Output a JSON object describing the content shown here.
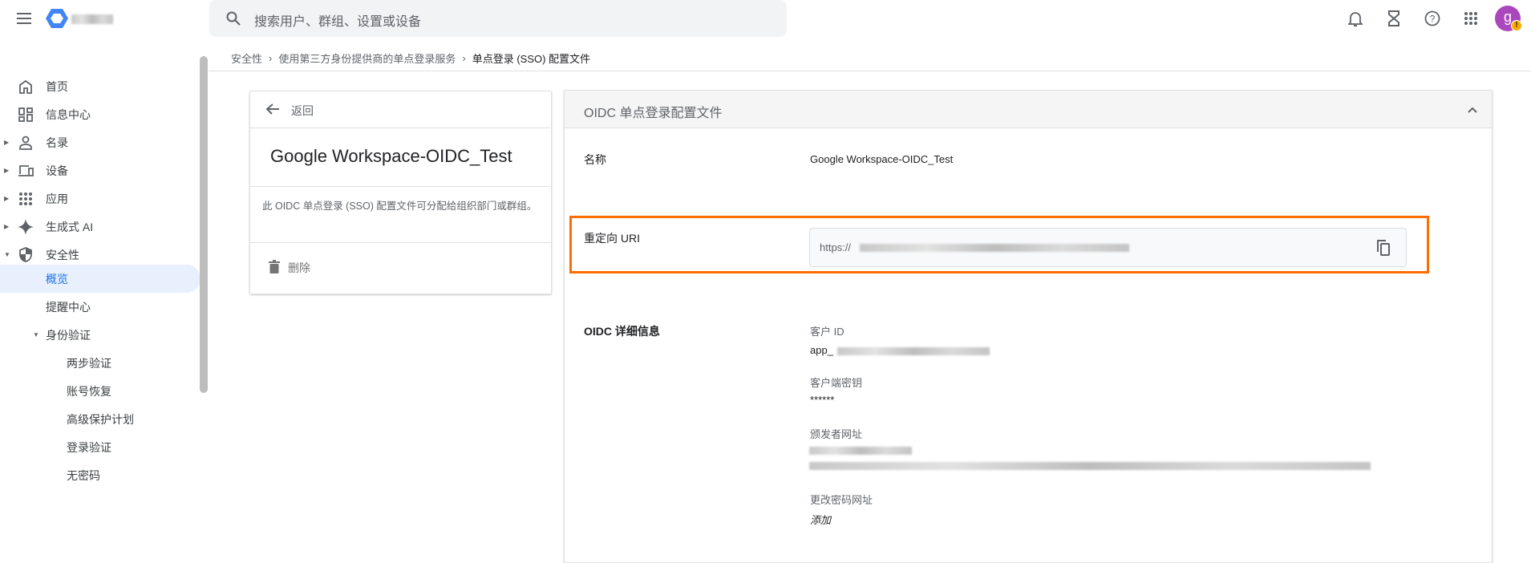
{
  "topbar": {
    "search_placeholder": "搜索用户、群组、设置或设备",
    "avatar_letter": "g"
  },
  "breadcrumb": [
    "安全性",
    "使用第三方身份提供商的单点登录服务",
    "单点登录 (SSO) 配置文件"
  ],
  "sidebar": {
    "items": [
      {
        "label": "首页",
        "icon": "home-icon"
      },
      {
        "label": "信息中心",
        "icon": "dashboard-icon"
      },
      {
        "label": "名录",
        "icon": "person-icon"
      },
      {
        "label": "设备",
        "icon": "devices-icon"
      },
      {
        "label": "应用",
        "icon": "apps-icon"
      },
      {
        "label": "生成式 AI",
        "icon": "sparkle-icon"
      },
      {
        "label": "安全性",
        "icon": "shield-icon"
      },
      {
        "label": "概览"
      },
      {
        "label": "提醒中心"
      },
      {
        "label": "身份验证"
      },
      {
        "label": "两步验证"
      },
      {
        "label": "账号恢复"
      },
      {
        "label": "高级保护计划"
      },
      {
        "label": "登录验证"
      },
      {
        "label": "无密码"
      }
    ]
  },
  "left_card": {
    "back": "返回",
    "title": "Google Workspace-OIDC_Test",
    "description": "此 OIDC 单点登录 (SSO) 配置文件可分配给组织部门或群组。",
    "delete": "删除"
  },
  "right_card": {
    "header": "OIDC 单点登录配置文件",
    "name_label": "名称",
    "name_value": "Google Workspace-OIDC_Test",
    "redirect_label": "重定向 URI",
    "redirect_prefix": "https://",
    "details_label": "OIDC 详细信息",
    "client_id_label": "客户 ID",
    "client_id_prefix": "app_",
    "secret_label": "客户端密钥",
    "secret_value": "******",
    "issuer_label": "颁发者网址",
    "change_pwd_label": "更改密码网址",
    "change_pwd_value": "添加"
  },
  "colors": {
    "accent": "#1a73e8",
    "highlight": "#ff6d00",
    "avatar": "#ab47bc"
  }
}
